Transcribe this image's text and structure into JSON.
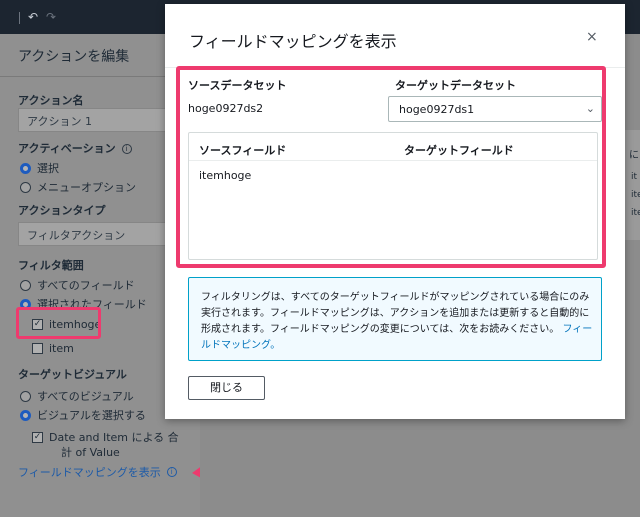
{
  "toolbar": {
    "undo_icon": "undo-icon",
    "redo_icon": "redo-icon"
  },
  "left_panel": {
    "title": "アクションを編集",
    "action_name_label": "アクション名",
    "action_name_value": "アクション 1",
    "activation_label": "アクティベーション",
    "activation_options": [
      "選択",
      "メニューオプション"
    ],
    "action_type_label": "アクションタイプ",
    "action_type_value": "フィルタアクション",
    "filter_scope_label": "フィルタ範囲",
    "filter_scope_options": [
      "すべてのフィールド",
      "選択されたフィールド"
    ],
    "fields": [
      "itemhoge",
      "item"
    ],
    "target_visual_label": "ターゲットビジュアル",
    "target_visual_options": [
      "すべてのビジュアル",
      "ビジュアルを選択する"
    ],
    "visual_item_line1": "Date and Item による 合",
    "visual_item_line2": "計 of Value",
    "show_mapping_link": "フィールドマッピングを表示"
  },
  "right_card": {
    "header": "に",
    "rows": [
      "it",
      "ite",
      "ite"
    ]
  },
  "modal": {
    "title": "フィールドマッピングを表示",
    "close_glyph": "×",
    "source_dataset_label": "ソースデータセット",
    "source_dataset_value": "hoge0927ds2",
    "target_dataset_label": "ターゲットデータセット",
    "target_dataset_value": "hoge0927ds1",
    "table": {
      "col_source": "ソースフィールド",
      "col_target": "ターゲットフィールド",
      "rows": [
        {
          "source": "itemhoge",
          "target": ""
        }
      ]
    },
    "info_text": "フィルタリングは、すべてのターゲットフィールドがマッピングされている場合にのみ実行されます。フィールドマッピングは、アクションを追加または更新すると自動的に形成されます。フィールドマッピングの変更については、次をお読みください。",
    "info_link": "フィールドマッピング。",
    "close_button": "閉じる"
  },
  "colors": {
    "highlight": "#ee3a6e",
    "link": "#0073bb",
    "info_border": "#00a1c9",
    "radio_selected": "#1d5bbf"
  }
}
